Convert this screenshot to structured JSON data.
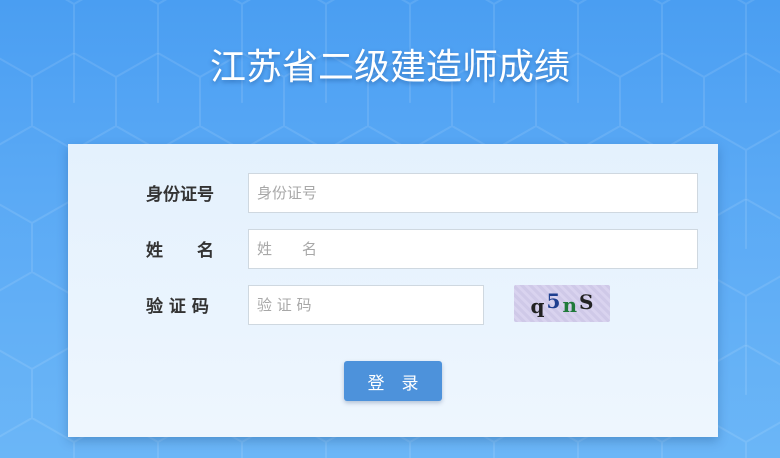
{
  "page": {
    "title": "江苏省二级建造师成绩"
  },
  "form": {
    "id_label": "身份证号",
    "id_placeholder": "身份证号",
    "name_label": "姓　　名",
    "name_placeholder": "姓　　名",
    "captcha_label": "验 证 码",
    "captcha_placeholder": "验 证 码",
    "captcha_chars": [
      {
        "ch": "q",
        "color": "#222222"
      },
      {
        "ch": "5",
        "color": "#1f3f8f"
      },
      {
        "ch": "n",
        "color": "#1f7a3a"
      },
      {
        "ch": "S",
        "color": "#222222"
      }
    ],
    "submit_label": "登　录"
  },
  "colors": {
    "background": "#5aa9f5",
    "panel": "#e8f3fe",
    "button": "#4d92db"
  }
}
